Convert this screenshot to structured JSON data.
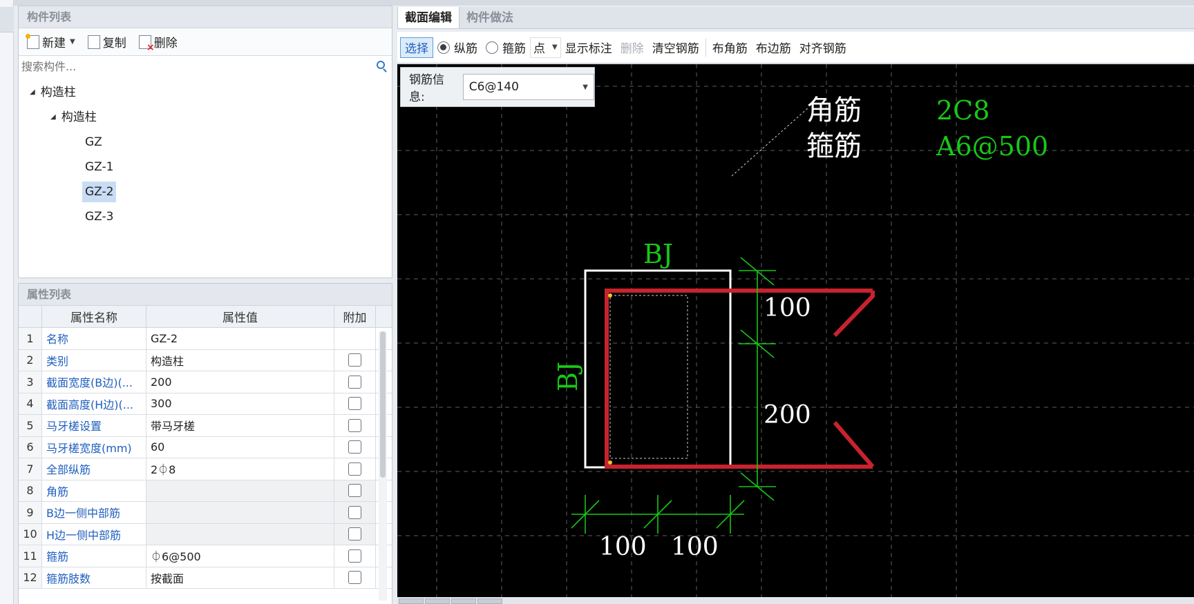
{
  "component_list": {
    "title": "构件列表",
    "toolbar": {
      "new_label": "新建",
      "copy_label": "复制",
      "delete_label": "删除"
    },
    "search_placeholder": "搜索构件...",
    "tree": {
      "root": "构造柱",
      "child": "构造柱",
      "items": [
        "GZ",
        "GZ-1",
        "GZ-2",
        "GZ-3"
      ],
      "selected": "GZ-2"
    }
  },
  "property_list": {
    "title": "属性列表",
    "headers": {
      "name": "属性名称",
      "value": "属性值",
      "extra": "附加"
    },
    "rows": [
      {
        "index": "1",
        "name": "名称",
        "value": "GZ-2"
      },
      {
        "index": "2",
        "name": "类别",
        "value": "构造柱"
      },
      {
        "index": "3",
        "name": "截面宽度(B边)(...",
        "value": "200"
      },
      {
        "index": "4",
        "name": "截面高度(H边)(...",
        "value": "300"
      },
      {
        "index": "5",
        "name": "马牙槎设置",
        "value": "带马牙槎"
      },
      {
        "index": "6",
        "name": "马牙槎宽度(mm)",
        "value": "60"
      },
      {
        "index": "7",
        "name": "全部纵筋",
        "value": "2⏀8"
      },
      {
        "index": "8",
        "name": "角筋",
        "value": ""
      },
      {
        "index": "9",
        "name": "B边一侧中部筋",
        "value": ""
      },
      {
        "index": "10",
        "name": "H边一侧中部筋",
        "value": ""
      },
      {
        "index": "11",
        "name": "箍筋",
        "value": "⏀6@500"
      },
      {
        "index": "12",
        "name": "箍筋肢数",
        "value": "按截面"
      }
    ]
  },
  "tabs": [
    "截面编辑",
    "构件做法"
  ],
  "section_toolbar": {
    "select": "选择",
    "longitudinal": "纵筋",
    "stirrup": "箍筋",
    "point": "点",
    "show_annotation": "显示标注",
    "delete": "删除",
    "clear_rebar": "清空钢筋",
    "corner_rebar": "布角筋",
    "edge_rebar": "布边筋",
    "align_rebar": "对齐钢筋"
  },
  "rebar_info": {
    "label": "钢筋信息:",
    "value": "C6@140"
  },
  "drawing": {
    "corner_label": "角筋",
    "corner_value": "2C8",
    "stirrup_label": "箍筋",
    "stirrup_value": "A6@500",
    "top_edge_label": "BJ",
    "left_edge_label": "BJ",
    "dim_right_top": "100",
    "dim_right_bottom": "200",
    "dim_bottom_left": "100",
    "dim_bottom_right": "100"
  },
  "colors": {
    "canvas_bg": "#000000",
    "grid": "#5a5f66",
    "section_outline": "#ffffff",
    "stirrup_line": "#c8232c",
    "dimension": "#18c718",
    "annotation_text": "#ffffff",
    "accent": "#1f5fbf"
  }
}
